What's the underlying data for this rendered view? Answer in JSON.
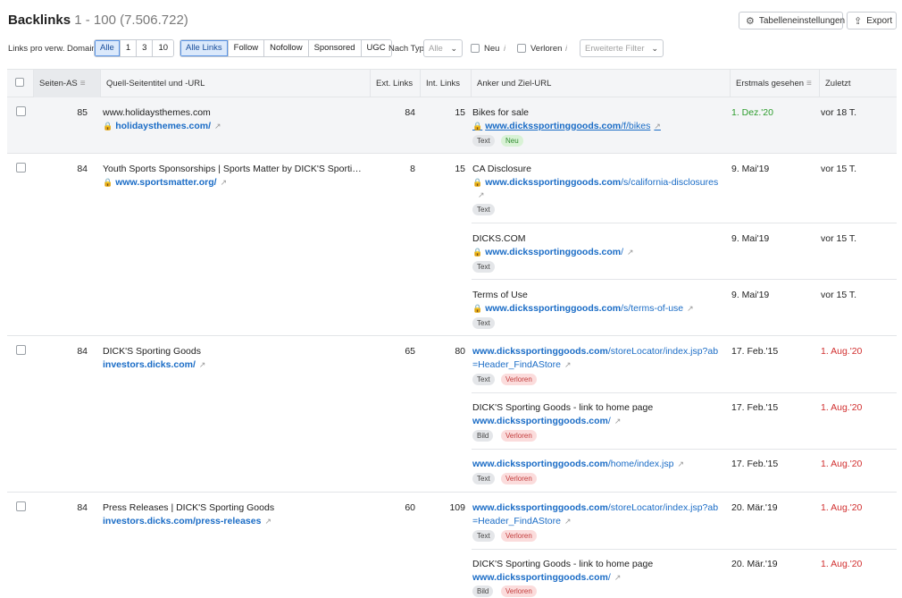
{
  "header": {
    "title": "Backlinks",
    "range": "1 - 100 (7.506.722)",
    "table_settings_label": "Tabelleneinstellungen",
    "export_label": "Export"
  },
  "filters": {
    "links_per_domain_label": "Links pro verw. Domain",
    "links_per_domain_options": [
      "Alle",
      "1",
      "3",
      "10"
    ],
    "link_type_options": [
      "Alle Links",
      "Follow",
      "Nofollow",
      "Sponsored",
      "UGC"
    ],
    "by_type_label": "Nach Typ",
    "by_type_value": "Alle",
    "new_label": "Neu",
    "lost_label": "Verloren",
    "info_glyph": "i",
    "advanced_filter_label": "Erweiterte Filter"
  },
  "columns": {
    "page_as": "Seiten-AS",
    "source": "Quell-Seitentitel und -URL",
    "ext_links": "Ext. Links",
    "int_links": "Int. Links",
    "anchor": "Anker und Ziel-URL",
    "first_seen": "Erstmals gesehen",
    "last_seen": "Zuletzt gesehen"
  },
  "rows": [
    {
      "as": "85",
      "title": "www.holidaysthemes.com",
      "url": "holidaysthemes.com/",
      "ext": "84",
      "int": "15",
      "links": [
        {
          "anchor": "Bikes for sale",
          "domain": "www.dickssportinggoods.com",
          "path": "/f/bikes",
          "tags": [
            "Text",
            "Neu"
          ],
          "first": "1. Dez.'20",
          "last": "vor 18 T."
        }
      ]
    },
    {
      "as": "84",
      "title": "Youth Sports Sponsorships | Sports Matter by DICK'S Sporti…",
      "url": "www.sportsmatter.org/",
      "ext": "8",
      "int": "15",
      "links": [
        {
          "anchor": "CA Disclosure",
          "domain": "www.dickssportinggoods.com",
          "path": "/s/california-disclosures",
          "tags": [
            "Text"
          ],
          "first": "9. Mai'19",
          "last": "vor 15 T."
        },
        {
          "anchor": "DICKS.COM",
          "domain": "www.dickssportinggoods.com",
          "path": "/",
          "tags": [
            "Text"
          ],
          "first": "9. Mai'19",
          "last": "vor 15 T."
        },
        {
          "anchor": "Terms of Use",
          "domain": "www.dickssportinggoods.com",
          "path": "/s/terms-of-use",
          "tags": [
            "Text"
          ],
          "first": "9. Mai'19",
          "last": "vor 15 T."
        }
      ]
    },
    {
      "as": "84",
      "title": "DICK'S Sporting Goods",
      "url": "investors.dicks.com/",
      "ext": "65",
      "int": "80",
      "links": [
        {
          "anchor": "",
          "domain": "www.dickssportinggoods.com",
          "path": "/storeLocator/index.jsp?ab",
          "path2": "=Header_FindAStore",
          "tags": [
            "Text",
            "Verloren"
          ],
          "first": "17. Feb.'15",
          "last": "1. Aug.'20"
        },
        {
          "anchor": "DICK'S Sporting Goods - link to home page",
          "domain": "www.dickssportinggoods.com",
          "path": "/",
          "tags": [
            "Bild",
            "Verloren"
          ],
          "first": "17. Feb.'15",
          "last": "1. Aug.'20"
        },
        {
          "anchor": "",
          "domain": "www.dickssportinggoods.com",
          "path": "/home/index.jsp",
          "tags": [
            "Text",
            "Verloren"
          ],
          "first": "17. Feb.'15",
          "last": "1. Aug.'20"
        }
      ]
    },
    {
      "as": "84",
      "title": "Press Releases | DICK'S Sporting Goods",
      "url": "investors.dicks.com/press-releases",
      "ext": "60",
      "int": "109",
      "links": [
        {
          "anchor": "",
          "domain": "www.dickssportinggoods.com",
          "path": "/storeLocator/index.jsp?ab",
          "path2": "=Header_FindAStore",
          "tags": [
            "Text",
            "Verloren"
          ],
          "first": "20. Mär.'19",
          "last": "1. Aug.'20"
        },
        {
          "anchor": "DICK'S Sporting Goods - link to home page",
          "domain": "www.dickssportinggoods.com",
          "path": "/",
          "tags": [
            "Bild",
            "Verloren"
          ],
          "first": "20. Mär.'19",
          "last": "1. Aug.'20"
        }
      ]
    }
  ],
  "colors": {
    "accent": "#1a6cc6",
    "new": "#2c9c2c",
    "lost": "#d12f2f"
  }
}
